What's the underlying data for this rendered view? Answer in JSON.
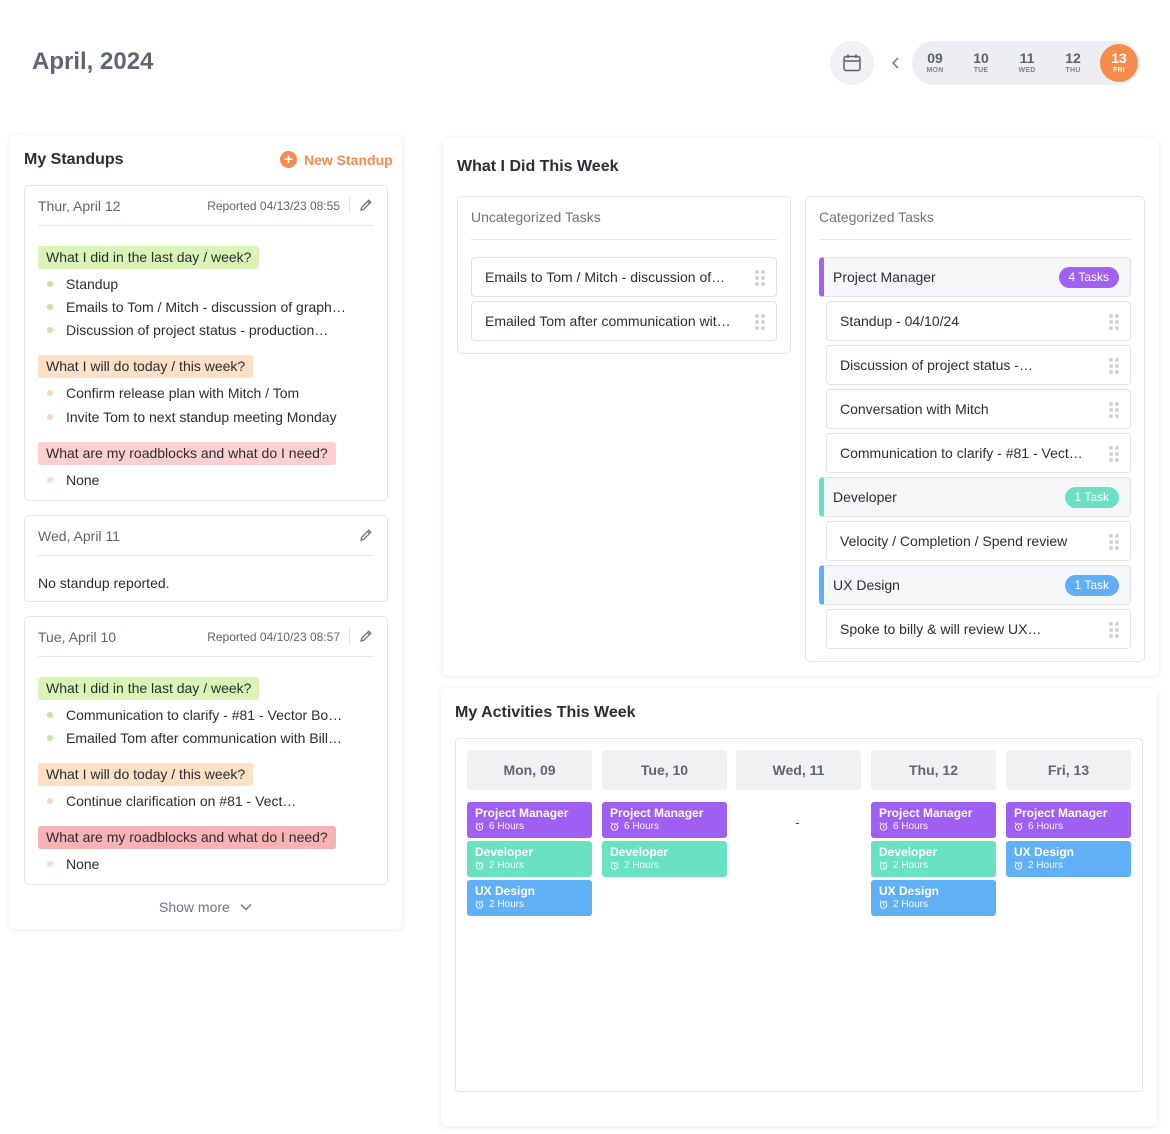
{
  "header": {
    "title": "April, 2024",
    "days": [
      {
        "num": "09",
        "dow": "MON"
      },
      {
        "num": "10",
        "dow": "TUE"
      },
      {
        "num": "11",
        "dow": "WED"
      },
      {
        "num": "12",
        "dow": "THU"
      },
      {
        "num": "13",
        "dow": "FRI"
      }
    ],
    "active_day": "13"
  },
  "standups": {
    "title": "My Standups",
    "new_label": "New Standup",
    "show_more": "Show more",
    "entries": [
      {
        "date": "Thur, April 12",
        "reported": "Reported 04/13/23 08:55",
        "q1": "What I did in the last day / week?",
        "q1_items": [
          "Standup",
          "Emails to Tom / Mitch - discussion of graph…",
          "Discussion of project status - production…"
        ],
        "q2": "What I will do today / this week?",
        "q2_items": [
          "Confirm release plan with Mitch / Tom",
          "Invite Tom to next standup meeting Monday"
        ],
        "q3": "What are my roadblocks and what do I need?",
        "q3_items": [
          "None"
        ]
      },
      {
        "date": "Wed, April 11",
        "empty_text": "No standup reported."
      },
      {
        "date": "Tue, April 10",
        "reported": "Reported 04/10/23 08:57",
        "q1": "What I did in the last day / week?",
        "q1_items": [
          "Communication to clarify - #81 - Vector Bo…",
          "Emailed Tom after communication with Bill…"
        ],
        "q2": "What I will do today / this week?",
        "q2_items": [
          "Continue clarification on #81 - Vect…"
        ],
        "q3": "What are my roadblocks and what do I need?",
        "q3_items": [
          "None"
        ]
      }
    ]
  },
  "week": {
    "title": "What I Did This Week",
    "uncategorized_title": "Uncategorized Tasks",
    "uncategorized": [
      "Emails to Tom / Mitch - discussion of…",
      "Emailed Tom after communication wit…"
    ],
    "categorized_title": "Categorized Tasks",
    "categories": [
      {
        "name": "Project Manager",
        "count": "4 Tasks",
        "color": "#a060f0",
        "tasks": [
          "Standup - 04/10/24",
          "Discussion of project status -…",
          "Conversation with Mitch",
          "Communication to clarify - #81 - Vect…"
        ]
      },
      {
        "name": "Developer",
        "count": "1 Task",
        "color": "#6be0c4",
        "tasks": [
          "Velocity / Completion / Spend review"
        ]
      },
      {
        "name": "UX Design",
        "count": "1 Task",
        "color": "#60aef4",
        "tasks": [
          "Spoke to billy & will review UX…"
        ]
      }
    ]
  },
  "activities": {
    "title": "My Activities This Week",
    "columns": [
      {
        "label": "Mon, 09",
        "blocks": [
          {
            "role": "Project Manager",
            "hours": "6 Hours"
          },
          {
            "role": "Developer",
            "hours": "2 Hours"
          },
          {
            "role": "UX Design",
            "hours": "2 Hours"
          }
        ]
      },
      {
        "label": "Tue, 10",
        "blocks": [
          {
            "role": "Project Manager",
            "hours": "6 Hours"
          },
          {
            "role": "Developer",
            "hours": "2 Hours"
          }
        ]
      },
      {
        "label": "Wed, 11",
        "empty": "-"
      },
      {
        "label": "Thu, 12",
        "blocks": [
          {
            "role": "Project Manager",
            "hours": "6 Hours"
          },
          {
            "role": "Developer",
            "hours": "2 Hours"
          },
          {
            "role": "UX Design",
            "hours": "2 Hours"
          }
        ]
      },
      {
        "label": "Fri, 13",
        "blocks": [
          {
            "role": "Project Manager",
            "hours": "6 Hours"
          },
          {
            "role": "UX Design",
            "hours": "2 Hours"
          }
        ]
      }
    ]
  },
  "colors": {
    "accent": "#f58b4c",
    "project_manager": "#9f5ff3",
    "developer": "#69e2c2",
    "ux_design": "#60b0f6"
  }
}
